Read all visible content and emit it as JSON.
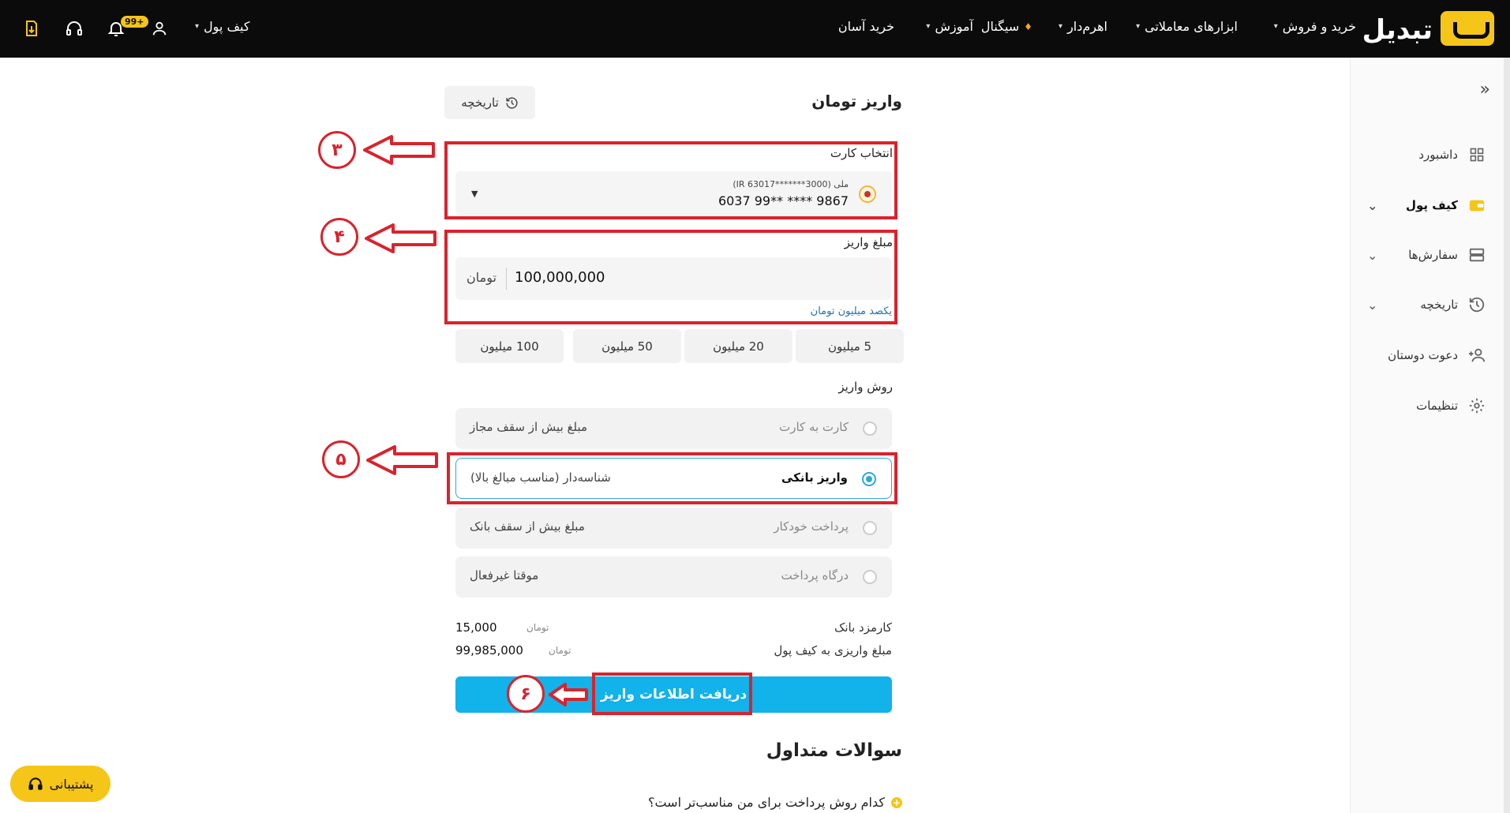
{
  "nav": {
    "logo_text": "تبدیل",
    "items": [
      {
        "label": "خرید و فروش",
        "caret": true
      },
      {
        "label": "ابزارهای معاملاتی",
        "caret": true
      },
      {
        "label": "اهرم‌دار",
        "caret": true
      },
      {
        "label": "سیگنال",
        "caret": false
      },
      {
        "label": "آموزش",
        "caret": true
      },
      {
        "label": "خرید آسان",
        "caret": false
      }
    ],
    "wallet_label": "کیف پول",
    "notification_count": "99+"
  },
  "sidebar": {
    "items": [
      {
        "label": "داشبورد",
        "icon": "grid-icon"
      },
      {
        "label": "کیف پول",
        "icon": "wallet-icon",
        "active": true
      },
      {
        "label": "سفارش‌ها",
        "icon": "orders-icon"
      },
      {
        "label": "تاریخچه",
        "icon": "history-icon"
      },
      {
        "label": "دعوت دوستان",
        "icon": "invite-icon"
      },
      {
        "label": "تنظیمات",
        "icon": "gear-icon"
      }
    ]
  },
  "page": {
    "title": "واریز تومان",
    "history_button": "تاریخچه"
  },
  "card": {
    "label": "انتخاب کارت",
    "bank_line": "ملی (IR 63017*******3000)",
    "number": "6037 99** **** 9867"
  },
  "amount": {
    "label": "مبلغ واریز",
    "value": "100,000,000",
    "unit": "تومان",
    "in_words": "یکصد میلیون تومان"
  },
  "quick_amounts": [
    "5 میلیون",
    "20 میلیون",
    "50 میلیون",
    "100 میلیون"
  ],
  "methods": {
    "label": "روش واریز",
    "options": [
      {
        "name": "کارت به کارت",
        "note": "مبلغ بیش از سقف مجاز",
        "selected": false
      },
      {
        "name": "واریز بانکی",
        "note": "شناسه‌دار (مناسب مبالغ بالا)",
        "selected": true
      },
      {
        "name": "پرداخت خودکار",
        "note": "مبلغ بیش از سقف بانک",
        "selected": false
      },
      {
        "name": "درگاه پرداخت",
        "note": "موقتا غیرفعال",
        "selected": false
      }
    ]
  },
  "fees": [
    {
      "label": "کارمزد بانک",
      "value": "15,000",
      "unit": "تومان"
    },
    {
      "label": "مبلغ واریزی به کیف پول",
      "value": "99,985,000",
      "unit": "تومان"
    }
  ],
  "submit_label": "دریافت اطلاعات واریز",
  "faq": {
    "title": "سوالات متداول",
    "first_question": "کدام روش پرداخت برای من مناسب‌تر است؟"
  },
  "support_label": "پشتیبانی",
  "annotations": [
    "۳",
    "۴",
    "۵",
    "۶"
  ],
  "colors": {
    "brand": "#f5c518",
    "accent": "#12b2ea",
    "annotation": "#d9232d"
  }
}
